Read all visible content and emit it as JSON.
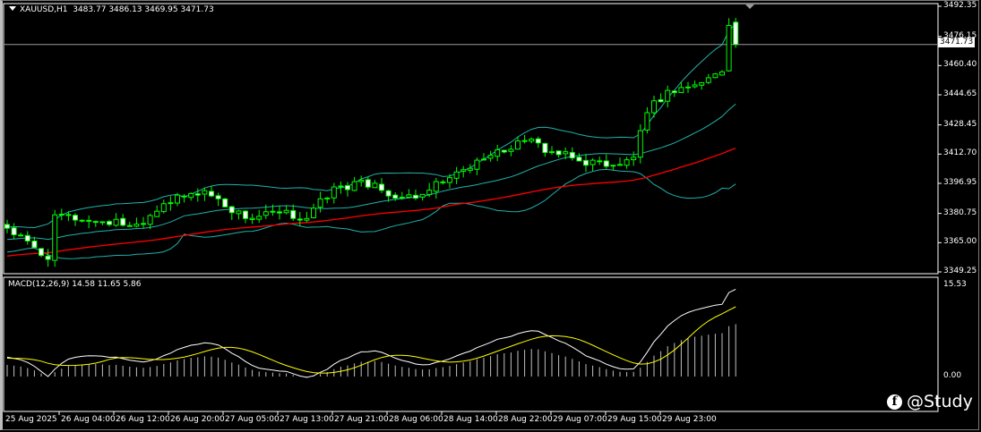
{
  "header": {
    "symbol": "XAUUSD,H1",
    "ohlc": "3483.77 3486.13 3469.95 3471.73"
  },
  "macd_header": "MACD(12,26,9) 14.58 11.65 5.86",
  "last_price": "3471.73",
  "watermark": "@Study",
  "colors": {
    "bull_outline": "#00ff00",
    "bear_body": "#ffffff",
    "bands": "#20b2aa",
    "ma": "#ff0000",
    "macd_line": "#ffffff",
    "signal": "#ffff00",
    "histogram": "#c0c0c0"
  },
  "chart_data": {
    "type": "candlestick",
    "symbol": "XAUUSD",
    "timeframe": "H1",
    "price_axis_labels": [
      "3492.35",
      "3476.15",
      "3460.40",
      "3444.65",
      "3428.45",
      "3412.70",
      "3396.95",
      "3380.75",
      "3365.00",
      "3349.25"
    ],
    "price_range": [
      3349.25,
      3492.35
    ],
    "time_labels": [
      "25 Aug 2025",
      "26 Aug 04:00",
      "26 Aug 12:00",
      "26 Aug 20:00",
      "27 Aug 05:00",
      "27 Aug 13:00",
      "27 Aug 21:00",
      "28 Aug 06:00",
      "28 Aug 14:00",
      "28 Aug 22:00",
      "29 Aug 07:00",
      "29 Aug 15:00",
      "29 Aug 23:00"
    ],
    "candle_count": 108,
    "close_anchors": [
      [
        0,
        3372.8
      ],
      [
        6,
        3356
      ],
      [
        7,
        3380
      ],
      [
        12,
        3377
      ],
      [
        19,
        3375
      ],
      [
        23,
        3386
      ],
      [
        29,
        3393
      ],
      [
        35,
        3378
      ],
      [
        40,
        3381
      ],
      [
        44,
        3378
      ],
      [
        48,
        3395
      ],
      [
        54,
        3397
      ],
      [
        57,
        3389
      ],
      [
        61,
        3391
      ],
      [
        65,
        3400
      ],
      [
        70,
        3410
      ],
      [
        76,
        3420
      ],
      [
        80,
        3414
      ],
      [
        84,
        3409
      ],
      [
        90,
        3407
      ],
      [
        92,
        3411
      ],
      [
        94,
        3435
      ],
      [
        97,
        3447
      ],
      [
        101,
        3450
      ],
      [
        105,
        3457
      ],
      [
        106,
        3482
      ],
      [
        107,
        3471.73
      ]
    ],
    "last_candle": {
      "open": 3483.77,
      "high": 3486.13,
      "low": 3469.95,
      "close": 3471.73
    },
    "indicators": [
      "Bollinger Bands(20,2)",
      "Moving Average",
      "MACD(12,26,9)"
    ],
    "macd": {
      "main": 14.58,
      "signal": 11.65,
      "histogram": 5.86,
      "axis_labels": [
        "15.53",
        "0.00"
      ],
      "axis_range": [
        -6.2,
        15.53
      ]
    }
  }
}
